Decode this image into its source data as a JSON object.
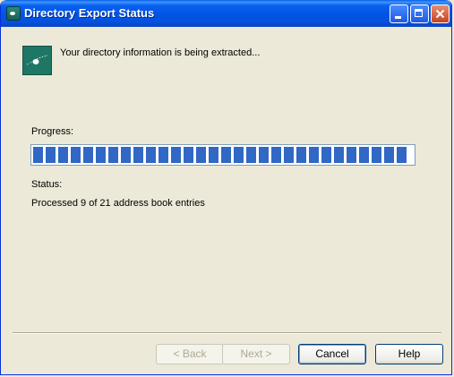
{
  "window": {
    "title": "Directory Export Status",
    "icon": "directory-export-icon"
  },
  "header": {
    "icon": "comet-icon",
    "message": "Your directory information is being extracted..."
  },
  "progress": {
    "label": "Progress:",
    "fraction": 0.99,
    "fill_color": "#3168c5"
  },
  "status": {
    "label": "Status:",
    "text": "Processed 9 of 21 address book entries"
  },
  "buttons": {
    "back": "< Back",
    "next": "Next >",
    "cancel": "Cancel",
    "help": "Help"
  }
}
